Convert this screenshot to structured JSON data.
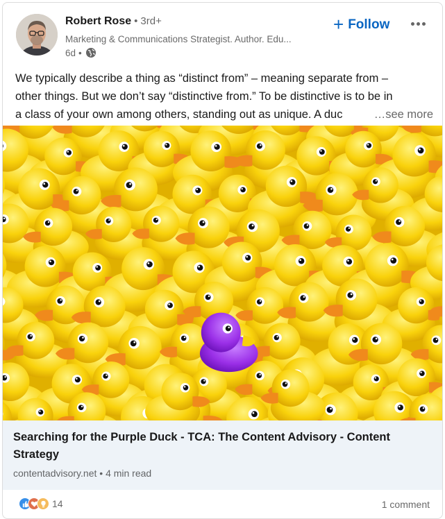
{
  "author": {
    "name": "Robert Rose",
    "degree": "3rd+",
    "headline": "Marketing & Communications Strategist. Author. Edu...",
    "time": "6d"
  },
  "actions": {
    "follow_label": "Follow",
    "plus_symbol": "+"
  },
  "post": {
    "lines": [
      "We typically describe a thing as “distinct from” – meaning separate from –",
      "other things. But we don’t say “distinctive from.” To be distinctive is to be in",
      "a class of your own among others, standing out as unique. A duc"
    ],
    "see_more": "…see more"
  },
  "article": {
    "title": "Searching for the Purple Duck - TCA: The Content Advisory - Content Strategy",
    "source": "contentadvisory.net",
    "read_time": "4 min read"
  },
  "social": {
    "reaction_count": "14",
    "comments": "1 comment"
  },
  "colors": {
    "accent": "#0a66c2",
    "duck_yellow": "#f9d20c",
    "duck_purple": "#9b30e8",
    "beak_orange": "#f08a1c",
    "preview_bg": "#eef3f8"
  },
  "icons": {
    "globe": "globe-icon",
    "more": "ellipsis-icon",
    "reactions": [
      "like-icon",
      "love-icon",
      "insightful-icon"
    ]
  }
}
